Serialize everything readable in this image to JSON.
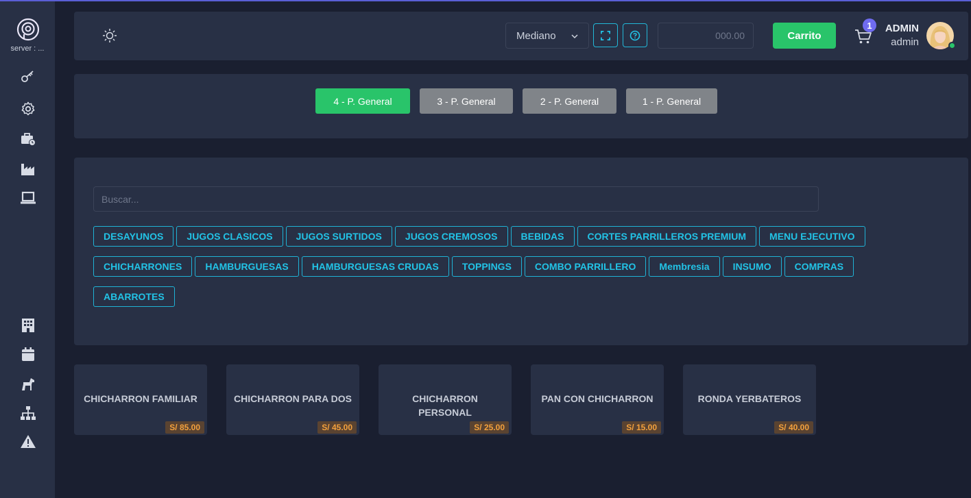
{
  "sidebar": {
    "server_label": "server : ...",
    "icons_top": [
      "key-icon",
      "gear-icon",
      "briefcase-clock-icon",
      "factory-icon",
      "laptop-icon"
    ],
    "icons_bottom": [
      "building-icon",
      "calendar-icon",
      "horse-icon",
      "sitemap-icon",
      "warning-icon"
    ]
  },
  "header": {
    "size_select": "Mediano",
    "amount_placeholder": "000.00",
    "carrito_label": "Carrito",
    "cart_count": "1",
    "user_name": "ADMIN",
    "user_role": "admin"
  },
  "price_lists": [
    {
      "label": "4 - P. General",
      "active": true
    },
    {
      "label": "3 - P. General",
      "active": false
    },
    {
      "label": "2 - P. General",
      "active": false
    },
    {
      "label": "1 - P. General",
      "active": false
    }
  ],
  "search": {
    "placeholder": "Buscar..."
  },
  "categories": [
    "DESAYUNOS",
    "JUGOS CLASICOS",
    "JUGOS SURTIDOS",
    "JUGOS CREMOSOS",
    "BEBIDAS",
    "CORTES PARRILLEROS PREMIUM",
    "MENU EJECUTIVO",
    "CHICHARRONES",
    "HAMBURGUESAS",
    "HAMBURGUESAS CRUDAS",
    "TOPPINGS",
    "COMBO PARRILLERO",
    "Membresia",
    "INSUMO",
    "COMPRAS",
    "ABARROTES"
  ],
  "products": [
    {
      "name": "CHICHARRON FAMILIAR",
      "price": "S/ 85.00"
    },
    {
      "name": "CHICHARRON PARA DOS",
      "price": "S/ 45.00"
    },
    {
      "name": "CHICHARRON PERSONAL",
      "price": "S/ 25.00"
    },
    {
      "name": "PAN CON CHICHARRON",
      "price": "S/ 15.00"
    },
    {
      "name": "RONDA YERBATEROS",
      "price": "S/ 40.00"
    }
  ],
  "colors": {
    "accent_green": "#29c46a",
    "accent_cyan": "#22c3e6",
    "price_orange": "#f3a13d",
    "badge_purple": "#6f6bf0"
  }
}
